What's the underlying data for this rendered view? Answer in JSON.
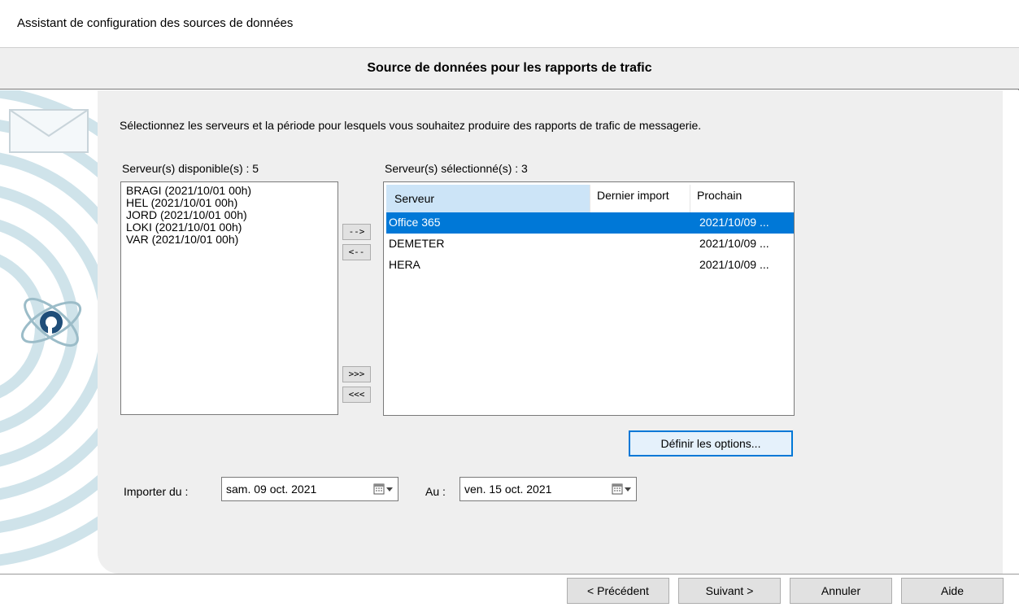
{
  "window": {
    "title": "Assistant de configuration des sources de données"
  },
  "header": {
    "title": "Source de données pour les rapports de trafic"
  },
  "intro": "Sélectionnez les serveurs et la période pour lesquels vous souhaitez produire des rapports de trafic de messagerie.",
  "available": {
    "label": "Serveur(s) disponible(s) : 5",
    "items": [
      "BRAGI (2021/10/01 00h)",
      "HEL (2021/10/01 00h)",
      "JORD (2021/10/01 00h)",
      "LOKI (2021/10/01 00h)",
      "VAR (2021/10/01 00h)"
    ]
  },
  "transfer": {
    "add": "-->",
    "remove": "<--",
    "add_all": ">>>",
    "remove_all": "<<<"
  },
  "selected": {
    "label": "Serveur(s) sélectionné(s) : 3",
    "columns": [
      "Serveur",
      "Dernier import",
      "Prochain"
    ],
    "rows": [
      {
        "server": "Office 365",
        "last": "",
        "next": "2021/10/09 ...",
        "selected": true
      },
      {
        "server": "DEMETER",
        "last": "",
        "next": "2021/10/09 ..."
      },
      {
        "server": "HERA",
        "last": "",
        "next": "2021/10/09 ..."
      }
    ]
  },
  "options_button": "Définir les options...",
  "import": {
    "from_label": "Importer du :",
    "from_value": "sam. 09 oct.  2021",
    "to_label": "Au :",
    "to_value": "ven. 15 oct.  2021"
  },
  "footer": {
    "prev": "< Précédent",
    "next": "Suivant >",
    "cancel": "Annuler",
    "help": "Aide"
  },
  "colors": {
    "selection": "#0078d7",
    "header_selected": "#cce4f7",
    "panel": "#efefef"
  }
}
